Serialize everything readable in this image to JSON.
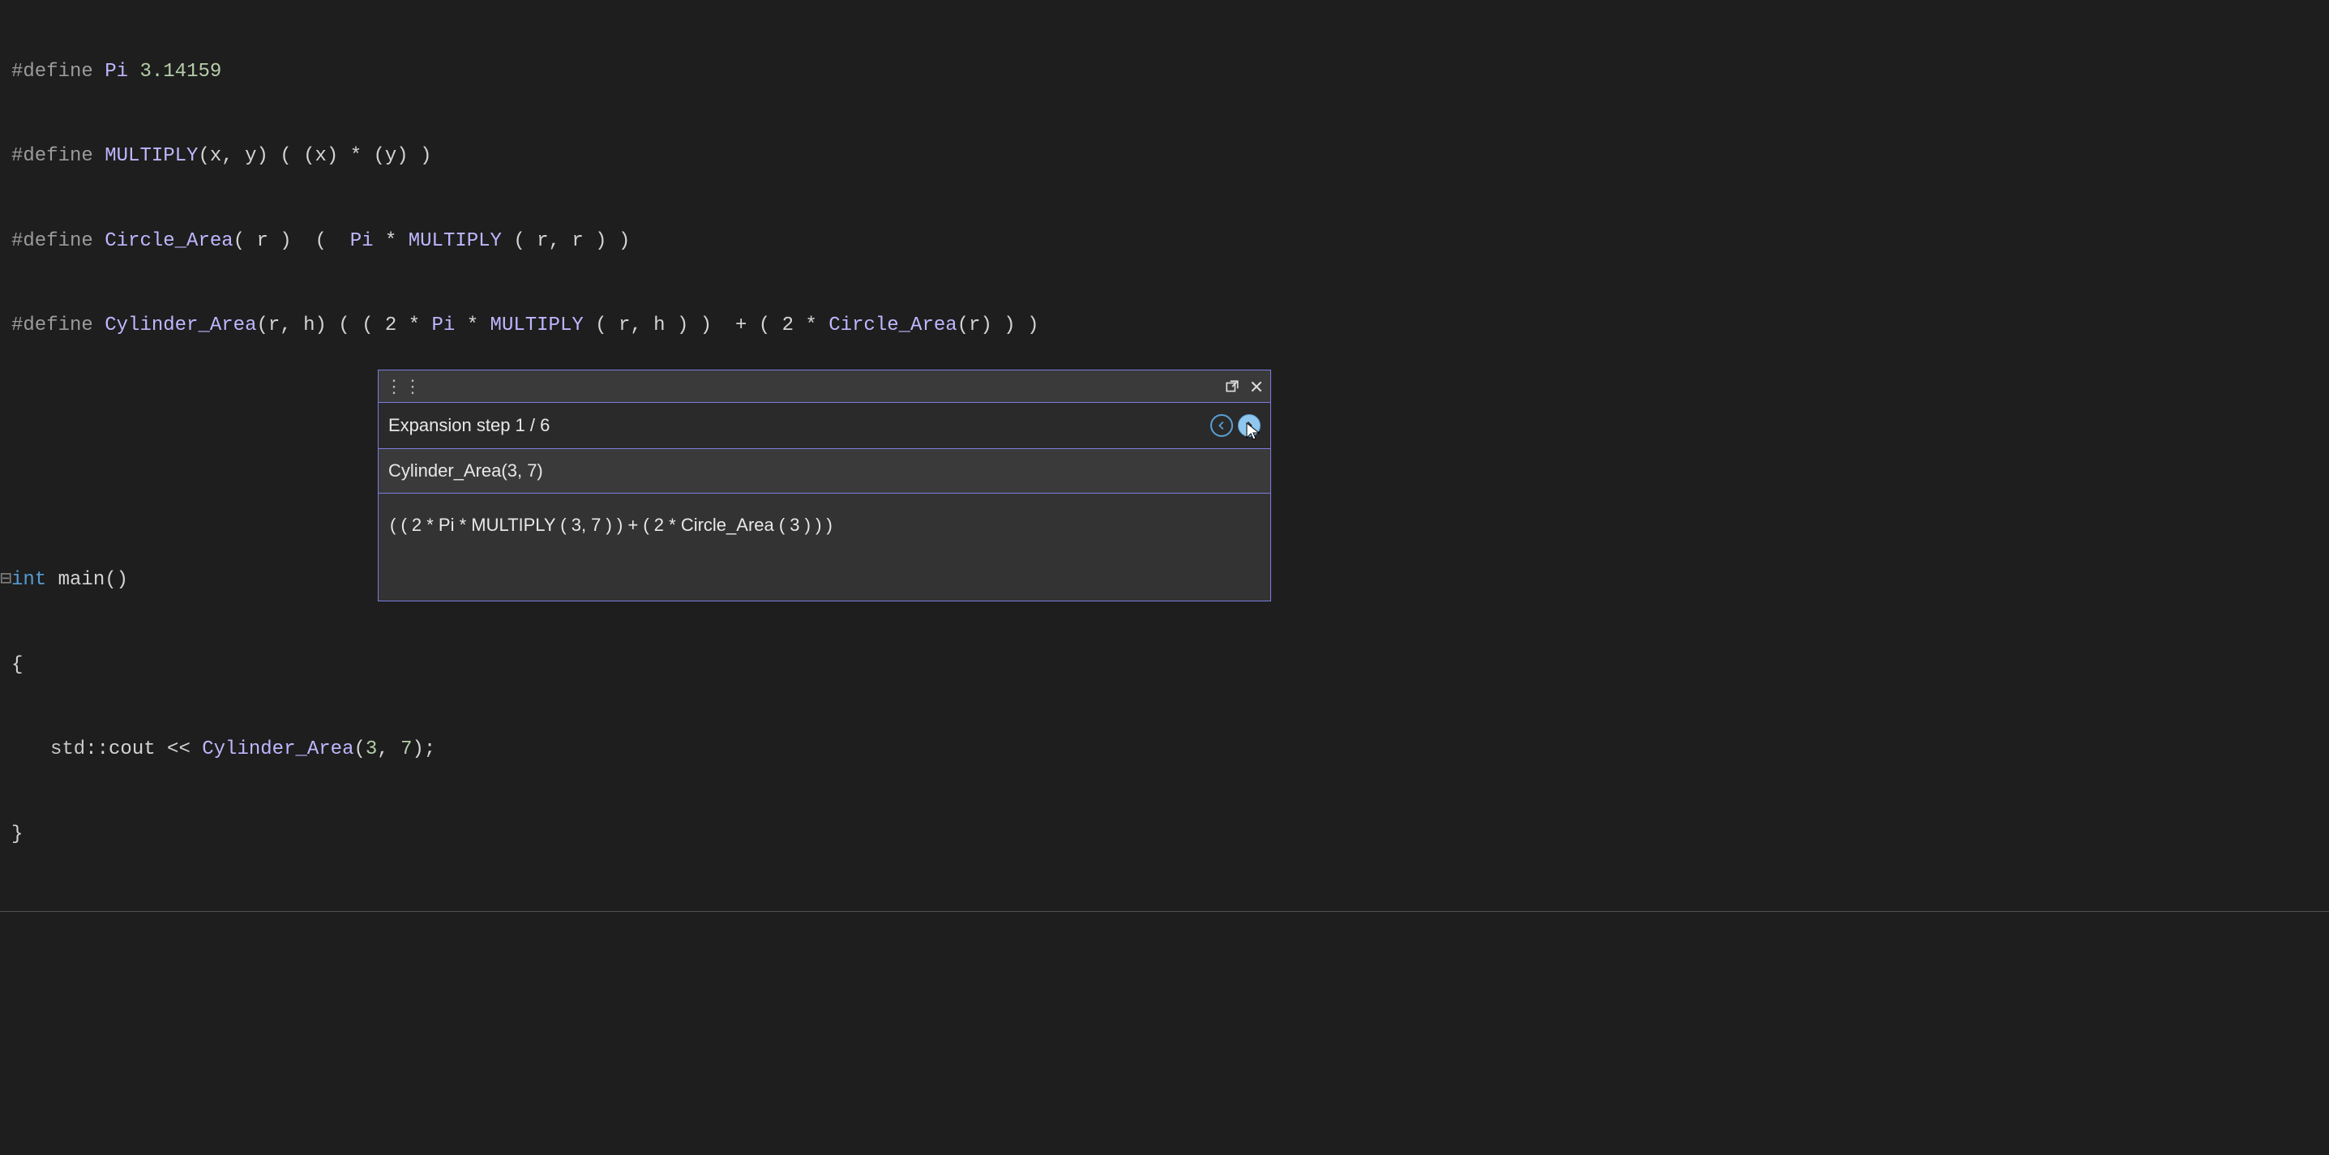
{
  "lines": {
    "l1_directive": "#define",
    "l1_name": "Pi",
    "l1_val": "3.14159",
    "l2_directive": "#define",
    "l2_name": "MULTIPLY",
    "l2_params": "(x, y)",
    "l2_body": "( (x) * (y) )",
    "l3_directive": "#define",
    "l3_name": "Circle_Area",
    "l3_params": "( r )",
    "l3_body_open": "  (  ",
    "l3_body_pi": "Pi",
    "l3_body_mid": " * ",
    "l3_body_mult": "MULTIPLY",
    "l3_body_multargs": " ( r, r ) )",
    "l4_directive": "#define",
    "l4_name": "Cylinder_Area",
    "l4_params": "(r, h)",
    "l4_body_open": " ( ( 2 * ",
    "l4_body_pi": "Pi",
    "l4_body_mid": " * ",
    "l4_body_mult": "MULTIPLY",
    "l4_body_multargs": " ( r, h ) )  + ( 2 * ",
    "l4_body_circ": "Circle_Area",
    "l4_body_end": "(r) ) )",
    "main_int": "int",
    "main_name": " main",
    "main_parens": "()",
    "brace_open": "{",
    "brace_close": "}",
    "cout_ns": "std",
    "cout_scope": "::",
    "cout_name": "cout",
    "cout_op": " << ",
    "cout_macro": "Cylinder_Area",
    "cout_args": "(",
    "cout_n1": "3",
    "cout_comma": ", ",
    "cout_n2": "7",
    "cout_end": ");"
  },
  "popup": {
    "grip": "⋮⋮",
    "step_label_prefix": "Expansion step ",
    "step_current": "1",
    "step_sep": " / ",
    "step_total": "6",
    "macro_call": "Cylinder_Area(3, 7)",
    "expansion": "( ( 2 * Pi * MULTIPLY ( 3, 7 ) ) + ( 2 * Circle_Area ( 3 ) ) )"
  }
}
